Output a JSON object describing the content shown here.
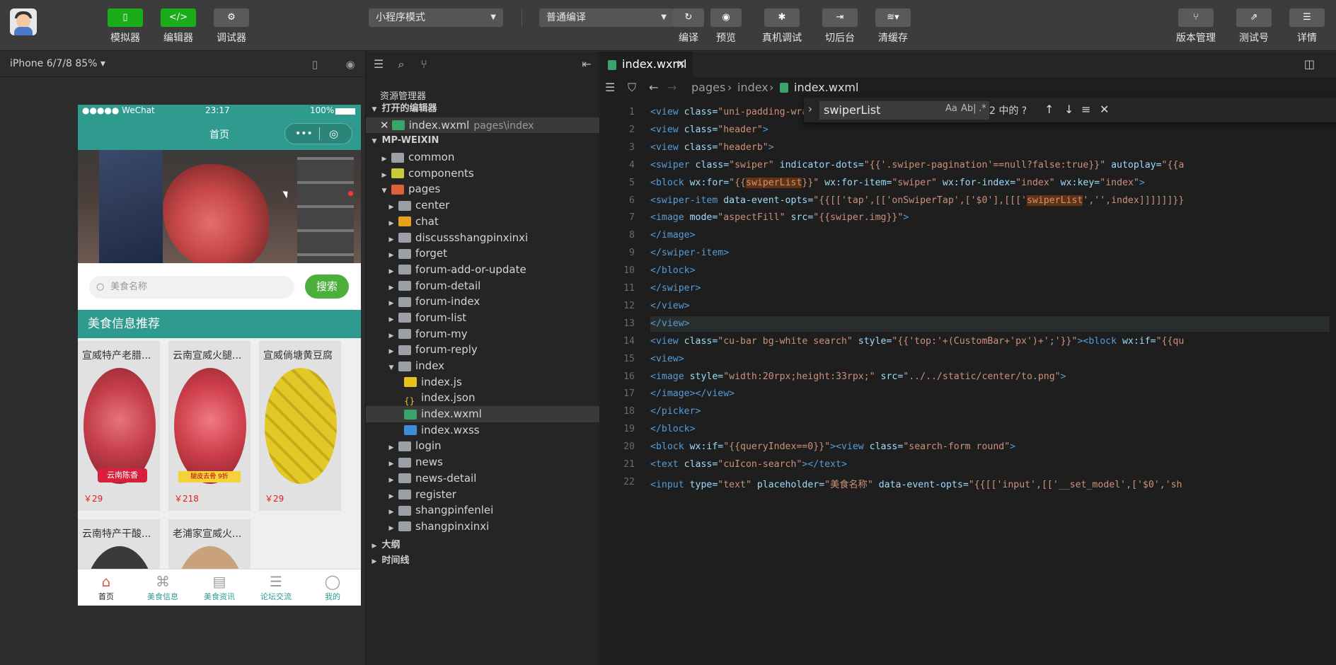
{
  "toolbar": {
    "simulator": "模拟器",
    "editor": "编辑器",
    "debugger": "调试器",
    "mode_select": "小程序模式",
    "compile_select": "普通编译",
    "compile": "编译",
    "preview": "预览",
    "remote_debug": "真机调试",
    "background": "切后台",
    "clear_cache": "清缓存",
    "version": "版本管理",
    "test_account": "测试号",
    "details": "详情"
  },
  "simulator": {
    "device": "iPhone 6/7/8 85% ▾",
    "status_carrier": "●●●●● WeChat",
    "status_time": "23:17",
    "status_battery": "100%",
    "nav_title": "首页",
    "search_placeholder": "美食名称",
    "search_button": "搜索",
    "section_title": "美食信息推荐",
    "cards": [
      {
        "name": "宣威特产老腊...",
        "price": "￥29"
      },
      {
        "name": "云南宣威火腿...",
        "price": "￥218"
      },
      {
        "name": "宣威倘塘黄豆腐",
        "price": "￥29"
      },
      {
        "name": "云南特产干酸...",
        "price": ""
      },
      {
        "name": "老浦家宣威火...",
        "price": ""
      }
    ],
    "card_overlays": [
      "云南陈香",
      "腿皮去骨 9折"
    ],
    "tabs": [
      "首页",
      "美食信息",
      "美食资讯",
      "论坛交流",
      "我的"
    ]
  },
  "explorer": {
    "title": "资源管理器",
    "open_editors": "打开的编辑器",
    "open_file": "index.wxml",
    "open_file_path": "pages\\index",
    "project": "MP-WEIXIN",
    "items": [
      "common",
      "components",
      "pages",
      "center",
      "chat",
      "discussshangpinxinxi",
      "forget",
      "forum-add-or-update",
      "forum-detail",
      "forum-index",
      "forum-list",
      "forum-my",
      "forum-reply",
      "index",
      "index.js",
      "index.json",
      "index.wxml",
      "index.wxss",
      "login",
      "news",
      "news-detail",
      "register",
      "shangpinfenlei",
      "shangpinxinxi"
    ],
    "outline": "大纲",
    "timeline": "时间线"
  },
  "editor": {
    "tab": "index.wxml",
    "crumb1": "pages",
    "crumb2": "index",
    "crumb3": "index.wxml",
    "find_query": "swiperList",
    "find_count": "2 中的 ?",
    "find_opt1": "Aa",
    "find_opt2": "Ab|",
    "find_opt3": ".*",
    "lines": [
      "<view class=\"uni-padding-wrap\">",
      "<view class=\"header\">",
      "<view class=\"headerb\">",
      "<swiper class=\"swiper\" indicator-dots=\"{{'.swiper-pagination'==null?false:true}}\" autoplay=\"{{a",
      "<block wx:for=\"{{swiperList}}\" wx:for-item=\"swiper\" wx:for-index=\"index\" wx:key=\"index\">",
      "<swiper-item data-event-opts=\"{{[['tap',[['onSwiperTap',['$0'],[[['swiperList','',index]]]]]]}}",
      "<image mode=\"aspectFill\" src=\"{{swiper.img}}\">",
      "</image>",
      "</swiper-item>",
      "</block>",
      "</swiper>",
      "</view>",
      "</view>",
      "<view class=\"cu-bar bg-white search\" style=\"{{'top:'+(CustomBar+'px')+';'}}\"><block wx:if=\"{{qu",
      "<view>",
      "<image style=\"width:20rpx;height:33rpx;\" src=\"../../static/center/to.png\">",
      "</image></view>",
      "</picker>",
      "</block>",
      "<block wx:if=\"{{queryIndex==0}}\"><view class=\"search-form round\">",
      "<text class=\"cuIcon-search\"></text>",
      "<input type=\"text\" placeholder=\"美食名称\" data-event-opts=\"{{[['input',[['__set_model',['$0','sh"
    ]
  }
}
